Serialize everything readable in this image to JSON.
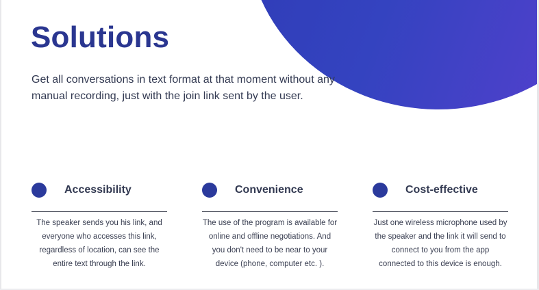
{
  "header": {
    "title": "Solutions",
    "subtitle": "Get all conversations in text format at that moment without any manual recording, just with the join link sent by the user."
  },
  "colors": {
    "accent_dark": "#2a3690",
    "gradient_start": "#2e3ab4",
    "gradient_end": "#5a3fd0",
    "text": "#333a52"
  },
  "features": [
    {
      "title": "Accessibility",
      "description": "The speaker sends you his link, and everyone who accesses this link, regardless of location, can see the entire text through the link."
    },
    {
      "title": "Convenience",
      "description": "The use of the program is available for online and offline negotiations. And you don't need to be near to your device (phone, computer etc. )."
    },
    {
      "title": "Cost-effective",
      "description": "Just one wireless microphone used by the speaker and the link it will send to connect to you from the app connected to this device is enough."
    }
  ]
}
